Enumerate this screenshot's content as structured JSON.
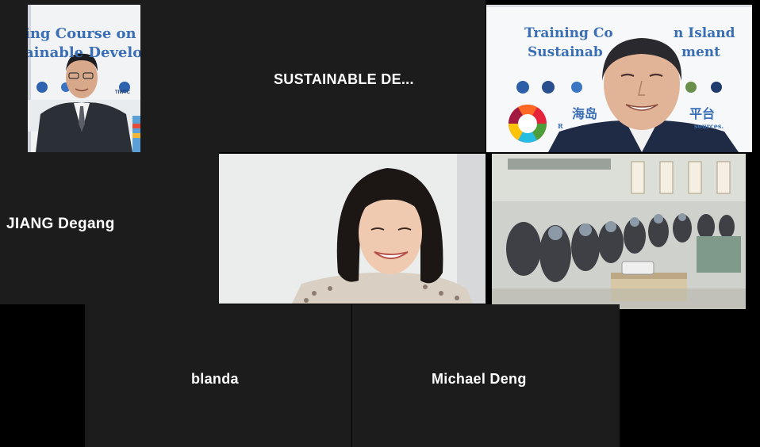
{
  "participants": {
    "p1": {
      "name": "JIANG Degang"
    },
    "p2": {
      "name": "SUSTAINABLE  DE..."
    },
    "p3": {
      "tag": ""
    },
    "p4": {
      "tag": ""
    },
    "p5": {
      "tag": ""
    },
    "p6": {
      "name": "blanda"
    },
    "p7": {
      "name": "Michael Deng"
    }
  },
  "banner": {
    "left_line1": "ing Course on I",
    "left_line2": "ainable Develop",
    "right_line1": "Training Co",
    "right_line1b": "n Island",
    "right_line2": "Sustainab",
    "right_line2b": "ment",
    "right_cn": "海岛",
    "right_cn_b": "平台",
    "right_small": "R",
    "right_small_b": "sources.",
    "left_logo_text": "TIWTC"
  },
  "colors": {
    "background": "#000000",
    "tile": "#1c1c1c",
    "banner_blue": "#3b6fb5",
    "text": "#ffffff"
  }
}
